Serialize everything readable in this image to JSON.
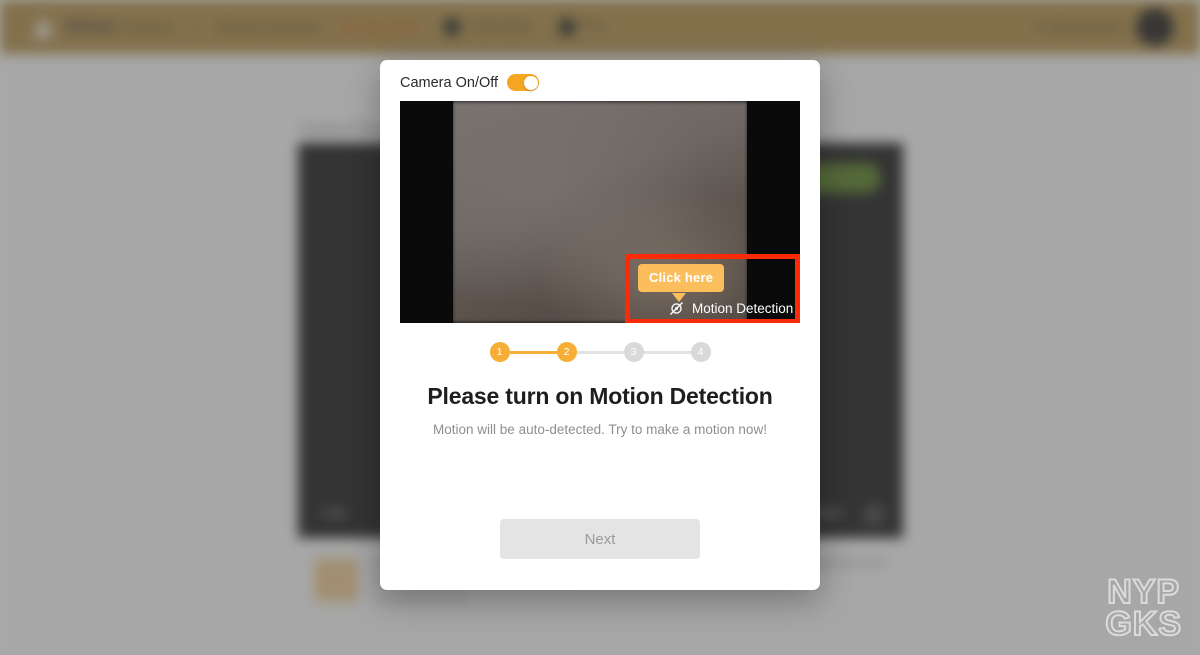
{
  "background": {
    "topbar": {
      "logo_icon": "triangle-logo-icon",
      "brand": "Alfred",
      "brand_sub": "Camera",
      "nav": [
        {
          "label": "Shared Cameras",
          "accent": false,
          "icon": null
        },
        {
          "label": "Live Chat",
          "accent": true,
          "icon": "record-dot-icon"
        },
        {
          "label": "Username",
          "accent": false,
          "icon": "user-chip-icon"
        },
        {
          "label": "Pro",
          "accent": false,
          "icon": "pro-chip-icon"
        }
      ],
      "account_menu": "My Account",
      "caret_icon": "chevron-down-icon",
      "avatar": "user-avatar"
    },
    "breadcrumb": "Camera Feed",
    "video_controls": {
      "left_label": "Live",
      "right_label": "Full screen",
      "fullscreen_icon": "expand-icon"
    },
    "green_button": "Connected",
    "lower_card": {
      "thumb_icon": "event-thumbnail-icon",
      "title": "Motion Event",
      "meta": "Recorded just now",
      "right_meta": "View all"
    }
  },
  "modal": {
    "camera_toggle": {
      "label": "Camera On/Off",
      "state": "on",
      "color": "#f5a623"
    },
    "video": {
      "highlight_color": "#fc2a06",
      "tooltip": "Click here",
      "tooltip_color": "#fbbe5c",
      "motion_label": "Motion Detection",
      "motion_icon": "motion-detection-off-icon"
    },
    "steps": [
      {
        "number": "1",
        "active": true
      },
      {
        "number": "2",
        "active": true
      },
      {
        "number": "3",
        "active": false
      },
      {
        "number": "4",
        "active": false
      }
    ],
    "title": "Please turn on Motion Detection",
    "subtitle": "Motion will be auto-detected. Try to make a motion now!",
    "next_button": "Next",
    "next_button_enabled": false
  },
  "watermark": {
    "line1": "NYP",
    "line2": "GKS"
  }
}
